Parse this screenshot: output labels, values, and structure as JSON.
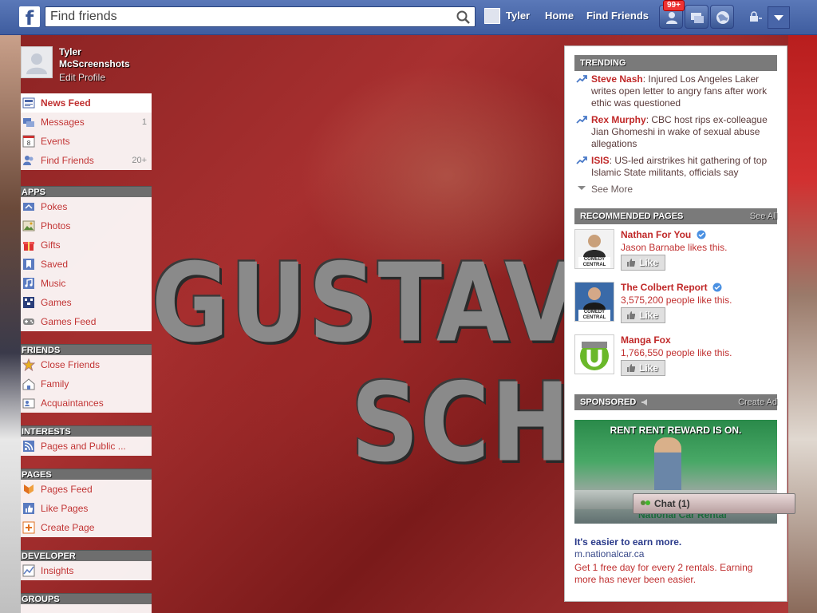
{
  "topbar": {
    "logo": "f",
    "search_placeholder": "Find friends",
    "user_name": "Tyler",
    "home": "Home",
    "find_friends": "Find Friends",
    "notifications_badge": "99+"
  },
  "cover": {
    "line1": "GUSTAV",
    "line2": "SCHÄF"
  },
  "profile": {
    "first_name": "Tyler",
    "last_name": "McScreenshots",
    "edit": "Edit Profile"
  },
  "sidebar": {
    "main": [
      {
        "label": "News Feed",
        "count": "",
        "icon": "news-feed-icon"
      },
      {
        "label": "Messages",
        "count": "1",
        "icon": "messages-icon"
      },
      {
        "label": "Events",
        "count": "",
        "icon": "events-icon",
        "icon_text": "8"
      },
      {
        "label": "Find Friends",
        "count": "20+",
        "icon": "find-friends-icon"
      }
    ],
    "apps_header": "APPS",
    "apps": [
      {
        "label": "Pokes",
        "icon": "pokes-icon"
      },
      {
        "label": "Photos",
        "icon": "photos-icon"
      },
      {
        "label": "Gifts",
        "icon": "gifts-icon"
      },
      {
        "label": "Saved",
        "icon": "saved-icon"
      },
      {
        "label": "Music",
        "icon": "music-icon"
      },
      {
        "label": "Games",
        "icon": "games-icon"
      },
      {
        "label": "Games Feed",
        "icon": "games-feed-icon"
      }
    ],
    "friends_header": "FRIENDS",
    "friends": [
      {
        "label": "Close Friends",
        "icon": "close-friends-icon"
      },
      {
        "label": "Family",
        "icon": "family-icon"
      },
      {
        "label": "Acquaintances",
        "icon": "acquaintances-icon"
      }
    ],
    "interests_header": "INTERESTS",
    "interests": [
      {
        "label": "Pages and Public ...",
        "icon": "rss-icon"
      }
    ],
    "pages_header": "PAGES",
    "pages": [
      {
        "label": "Pages Feed",
        "icon": "pages-feed-icon"
      },
      {
        "label": "Like Pages",
        "icon": "like-pages-icon"
      },
      {
        "label": "Create Page",
        "icon": "create-page-icon"
      }
    ],
    "developer_header": "DEVELOPER",
    "developer": [
      {
        "label": "Insights",
        "icon": "insights-icon"
      }
    ],
    "groups_header": "GROUPS"
  },
  "trending": {
    "header": "TRENDING",
    "items": [
      {
        "name": "Steve Nash",
        "text": ": Injured Los Angeles Laker writes open letter to angry fans after work ethic was questioned"
      },
      {
        "name": "Rex Murphy",
        "text": ": CBC host rips ex-colleague Jian Ghomeshi in wake of sexual abuse allegations"
      },
      {
        "name": "ISIS",
        "text": ": US-led airstrikes hit gathering of top Islamic State militants, officials say"
      }
    ],
    "see_more": "See More"
  },
  "recommended": {
    "header": "RECOMMENDED PAGES",
    "see_all": "See All",
    "pages": [
      {
        "name": "Nathan For You",
        "sub": "Jason Barnabe likes this.",
        "like": "Like",
        "thumb_text": "COMEDY CENTRAL",
        "verified": true
      },
      {
        "name": "The Colbert Report",
        "sub": "3,575,200 people like this.",
        "like": "Like",
        "thumb_text": "COMEDY CENTRAL",
        "verified": true
      },
      {
        "name": "Manga Fox",
        "sub": "1,766,550 people like this.",
        "like": "Like",
        "thumb_text": "",
        "verified": false
      }
    ]
  },
  "sponsored": {
    "header": "SPONSORED",
    "create_ad": "Create Ad",
    "image_headline": "RENT RENT REWARD IS ON.",
    "image_logo": "National Car Rental",
    "title": "It's easier to earn more.",
    "domain": "m.nationalcar.ca",
    "body": "Get 1 free day for every 2 rentals. Earning more has never been easier."
  },
  "chat": {
    "label": "Chat (1)"
  },
  "colors": {
    "fb_blue": "#3b5998",
    "link_red": "#c02828",
    "header_gray": "#7a7a7a"
  }
}
